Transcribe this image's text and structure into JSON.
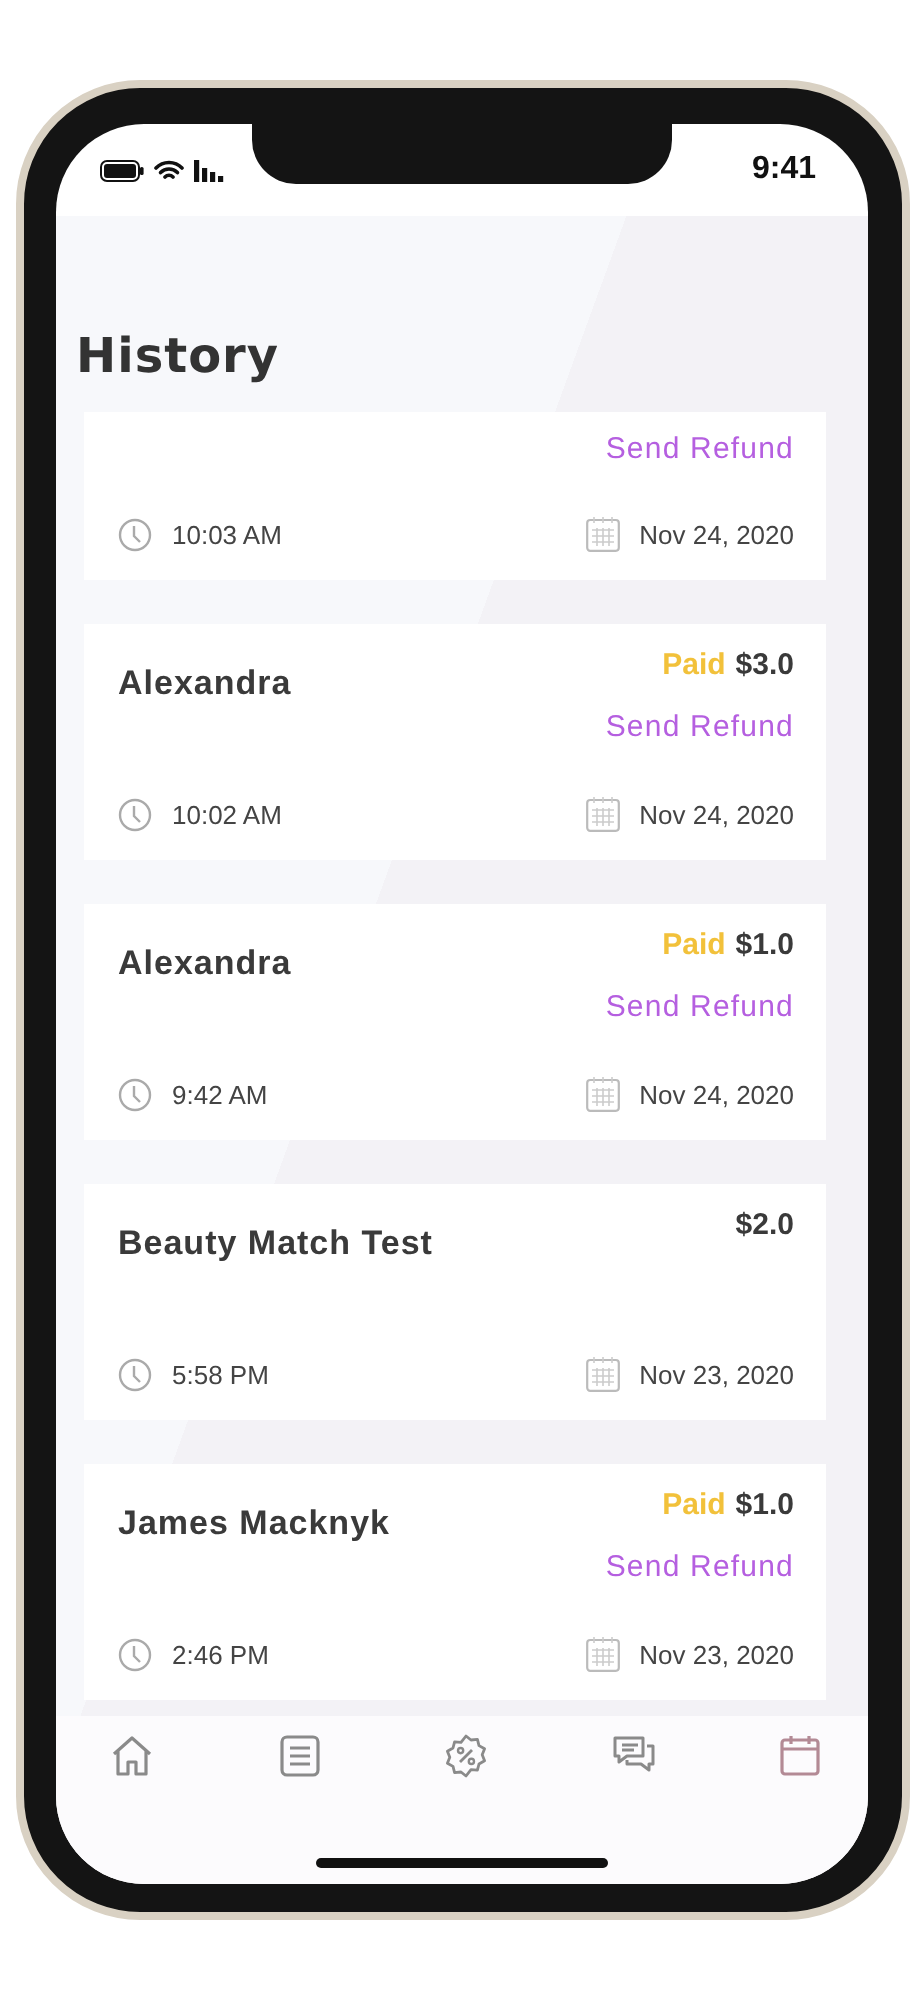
{
  "status_bar": {
    "time": "9:41"
  },
  "title": "History",
  "transactions": [
    {
      "time": "10:03 AM",
      "date": "Nov 24, 2020",
      "refund": "Send Refund"
    },
    {
      "name": "Alexandra",
      "status": "Paid",
      "amount": "$3.0",
      "refund": "Send Refund",
      "time": "10:02 AM",
      "date": "Nov 24, 2020"
    },
    {
      "name": "Alexandra",
      "status": "Paid",
      "amount": "$1.0",
      "refund": "Send Refund",
      "time": "9:42 AM",
      "date": "Nov 24, 2020"
    },
    {
      "name": "Beauty Match Test",
      "amount": "$2.0",
      "time": "5:58 PM",
      "date": "Nov 23, 2020"
    },
    {
      "name": "James Macknyk",
      "status": "Paid",
      "amount": "$1.0",
      "refund": "Send Refund",
      "time": "2:46 PM",
      "date": "Nov 23, 2020"
    }
  ],
  "tab_bar": [
    {
      "kind": "home",
      "selected": false
    },
    {
      "kind": "list",
      "selected": false
    },
    {
      "kind": "offers",
      "selected": false
    },
    {
      "kind": "chat",
      "selected": false
    },
    {
      "kind": "calendar",
      "selected": true
    }
  ]
}
